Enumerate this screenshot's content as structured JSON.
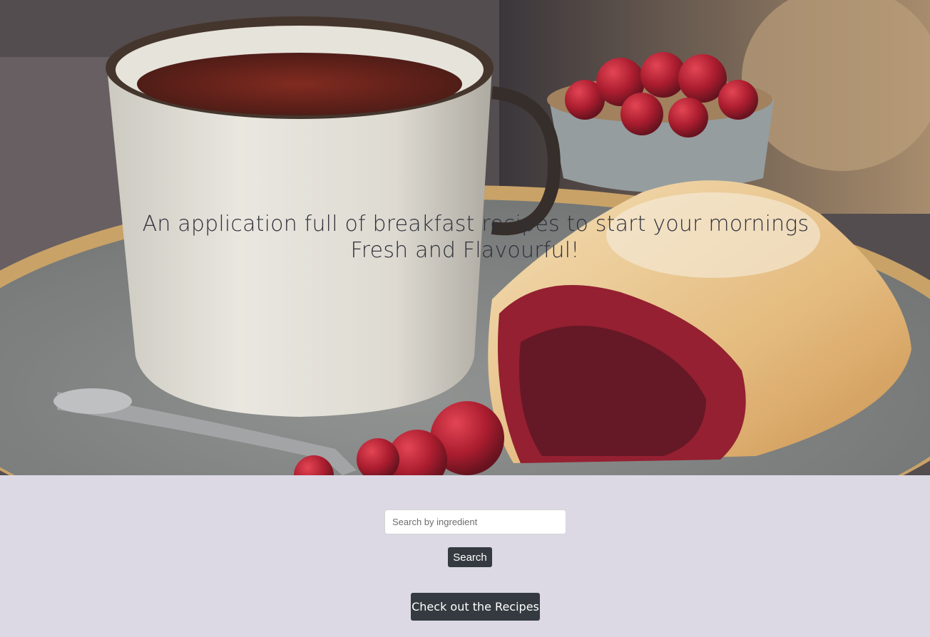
{
  "hero": {
    "image_alt": "Cup of tea with cherry strudel and cherries",
    "headline_line1": "An application full of breakfast recipes to start your mornings",
    "headline_line2": "Fresh and Flavourful!"
  },
  "search": {
    "placeholder": "Search by ingredient",
    "value": "",
    "button_label": "Search"
  },
  "cta": {
    "label": "Check out the Recipes"
  },
  "colors": {
    "page_background": "#dcd9e4",
    "button_background": "#343a40",
    "button_text": "#ffffff",
    "headline_text": "#2e2f3a"
  }
}
